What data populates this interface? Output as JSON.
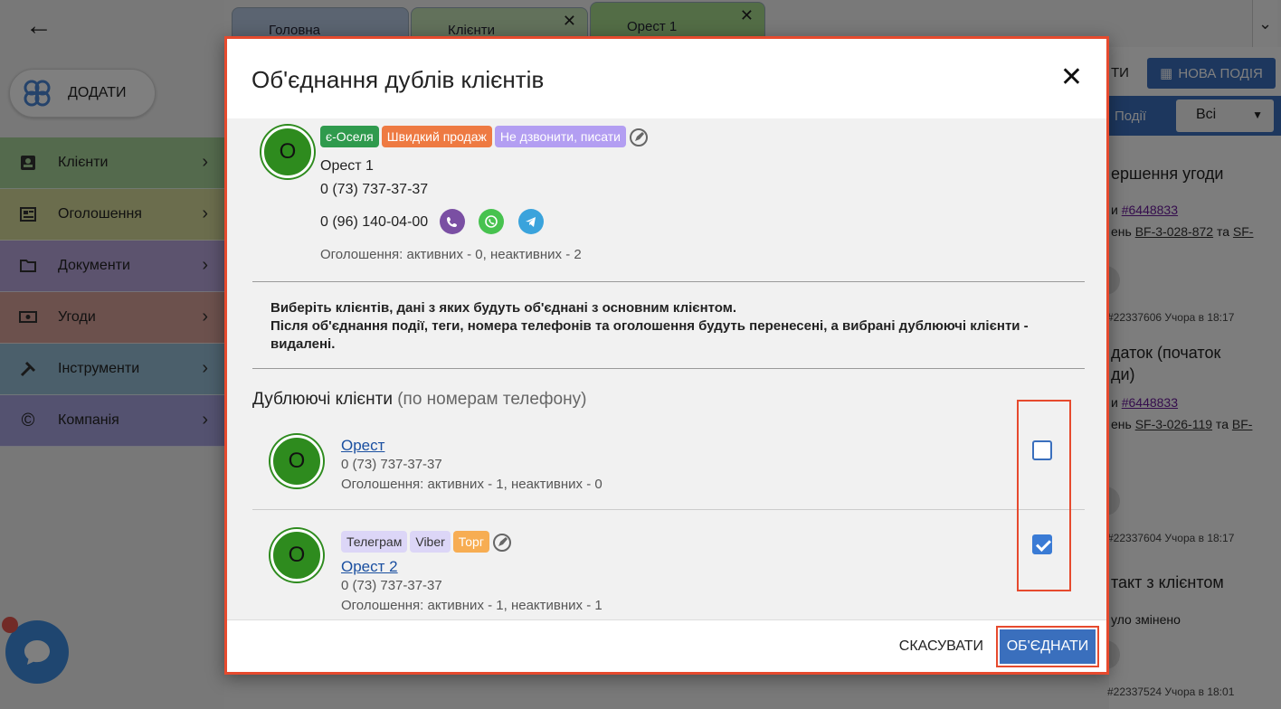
{
  "nav": {
    "add_label": "ДОДАТИ",
    "items": [
      {
        "label": "Клієнти"
      },
      {
        "label": "Оголошення"
      },
      {
        "label": "Документи"
      },
      {
        "label": "Угоди"
      },
      {
        "label": "Інструменти"
      },
      {
        "label": "Компанія"
      }
    ]
  },
  "tabs": [
    {
      "label": "Головна"
    },
    {
      "label": "Клієнти"
    },
    {
      "label": "Орест 1"
    }
  ],
  "right_panel": {
    "ti_text": "ТИ",
    "new_event_label": "НОВА ПОДІЯ",
    "events_label": "Події",
    "filter_value": "Всі",
    "items": [
      {
        "title": "ершення угоди",
        "line1_prefix": "и ",
        "deal": "#6448833",
        "line2_prefix": "ень ",
        "ref1": "BF-3-028-872",
        "ref_and": " та ",
        "ref2": "SF-",
        "meta": "#22337606   Учора в 18:17"
      },
      {
        "title": "даток (початок",
        "title2": "ди)",
        "line1_prefix": "и ",
        "deal": "#6448833",
        "line2_prefix": "ень ",
        "ref1": "SF-3-026-119",
        "ref_and": " та ",
        "ref2": "BF-",
        "meta": "#22337604   Учора в 18:17"
      },
      {
        "title": "такт з клієнтом",
        "line1": "уло змінено",
        "meta": "#22337524   Учора в 18:01"
      }
    ]
  },
  "modal": {
    "title": "Об'єднання дублів клієнтів",
    "main_client": {
      "initial": "О",
      "tags": [
        "є-Оселя",
        "Швидкий продаж",
        "Не дзвонити, писати"
      ],
      "name": "Орест 1",
      "phone1": "0 (73) 737-37-37",
      "phone2": "0 (96) 140-04-00",
      "ads": "Оголошення: активних - 0, неактивних - 2"
    },
    "notice_line1": "Виберіть клієнтів, дані з яких будуть об'єднані з основним клієнтом.",
    "notice_line2": "Після об'єднання події, теги, номера телефонів та оголошення будуть перенесені, а вибрані дублюючі клієнти - видалені.",
    "duplicates_title": "Дублюючі клієнти",
    "duplicates_subtitle": "(по номерам телефону)",
    "duplicates": [
      {
        "initial": "О",
        "name": "Орест",
        "phone": "0 (73) 737-37-37",
        "ads": "Оголошення: активних - 1, неактивних - 0",
        "checked": false,
        "tags": []
      },
      {
        "initial": "О",
        "name": "Орест 2",
        "phone": "0 (73) 737-37-37",
        "ads": "Оголошення: активних - 1, неактивних - 1",
        "checked": true,
        "tags": [
          "Телеграм",
          "Viber",
          "Торг"
        ]
      }
    ],
    "cancel_label": "СКАСУВАТИ",
    "merge_label": "ОБ'ЄДНАТИ"
  },
  "colors": {
    "accent_blue": "#3a6fbd",
    "highlight_red": "#e64a2e",
    "avatar_green": "#2e8b1e"
  }
}
